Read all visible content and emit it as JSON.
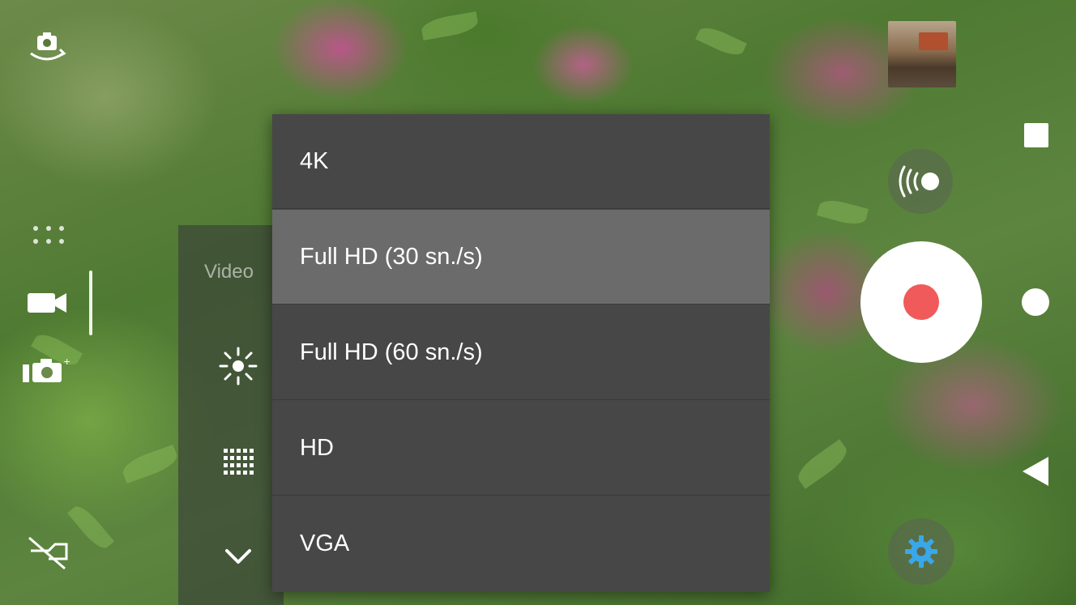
{
  "camera": {
    "panel": {
      "title": "Video"
    },
    "resolution_menu": {
      "options": [
        {
          "label": "4K",
          "selected": false
        },
        {
          "label": "Full HD (30 sn./s)",
          "selected": true
        },
        {
          "label": "Full HD (60 sn./s)",
          "selected": false
        },
        {
          "label": "HD",
          "selected": false
        },
        {
          "label": "VGA",
          "selected": false
        }
      ]
    },
    "icons": {
      "switch_camera": "switch-camera-icon",
      "more_modes": "dots-icon",
      "video_mode": "video-camera-icon",
      "photo_mode": "photo-camera-icon",
      "flash": "flash-off-icon",
      "exposure": "brightness-icon",
      "grid": "grid-icon",
      "expand": "chevron-down-icon",
      "stop": "stop-square-icon",
      "live": "live-broadcast-icon",
      "record": "record-icon",
      "home": "home-circle-icon",
      "back": "back-triangle-icon",
      "settings": "gear-icon"
    },
    "colors": {
      "record_red": "#f05a5a",
      "menu_bg": "#474747",
      "menu_selected": "#6b6b6b",
      "settings_blue": "#3aa7e8"
    }
  }
}
